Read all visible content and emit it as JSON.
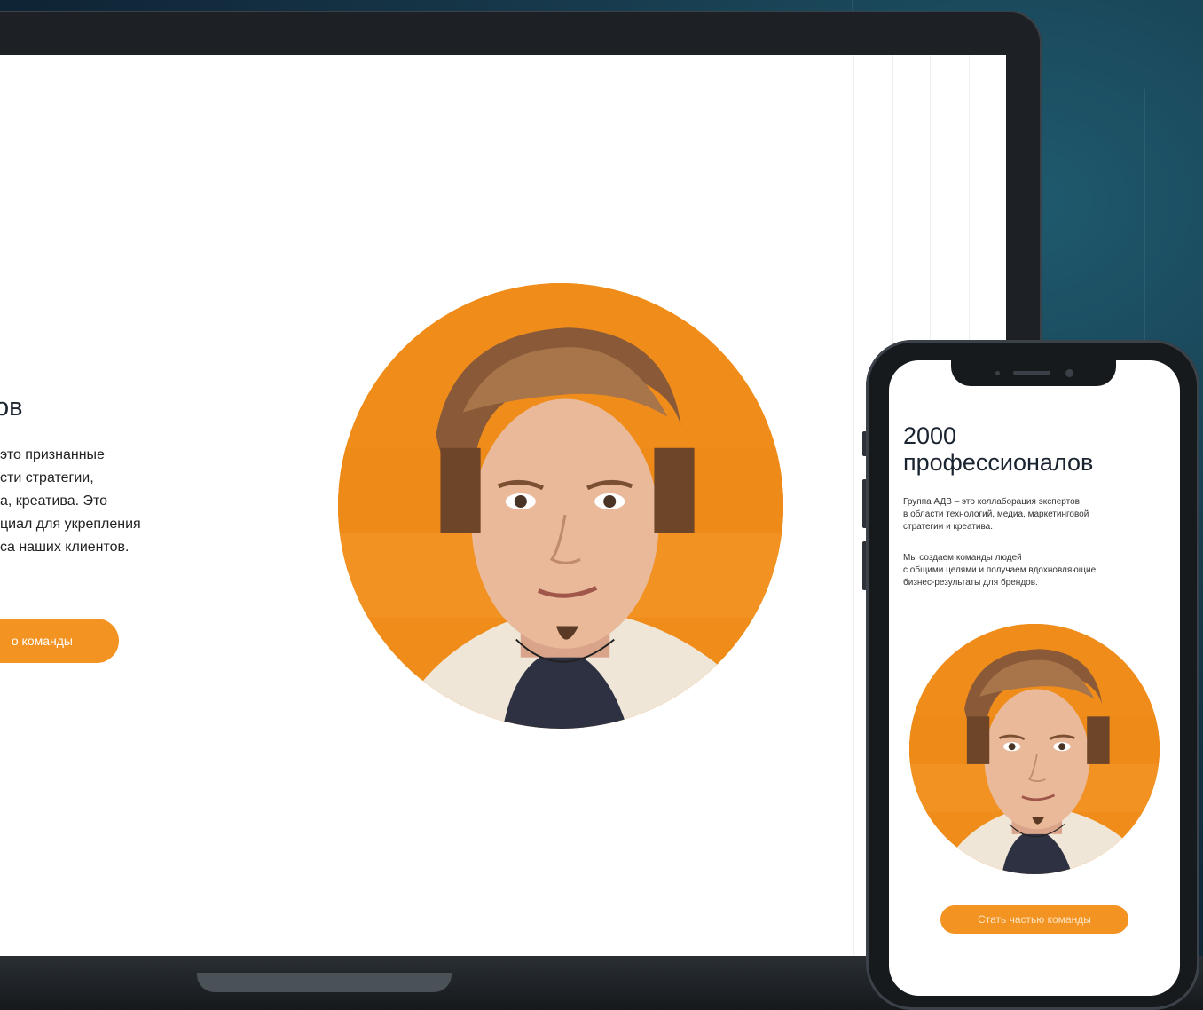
{
  "laptop": {
    "heading_fragment": "ов",
    "text_lines": [
      "это признанные",
      "сти стратегии,",
      "а, креатива. Это",
      "циал для укрепления",
      "са наших клиентов."
    ],
    "button_fragment": "о команды"
  },
  "phone": {
    "title_line1": "2000",
    "title_line2": "профессионалов",
    "paragraph1": [
      "Группа АДВ – это коллаборация экспертов",
      "в области технологий, медиа, маркетинговой",
      "стратегии и креатива."
    ],
    "paragraph2": [
      "Мы создаем команды людей",
      "с общими целями и получаем вдохновляющие",
      "бизнес-результаты для брендов."
    ],
    "button": "Стать частью команды"
  },
  "colors": {
    "accent": "#f39322",
    "portrait_bg": "#f08d1a",
    "background": "#173a4c",
    "device_frame": "#1d2125"
  }
}
